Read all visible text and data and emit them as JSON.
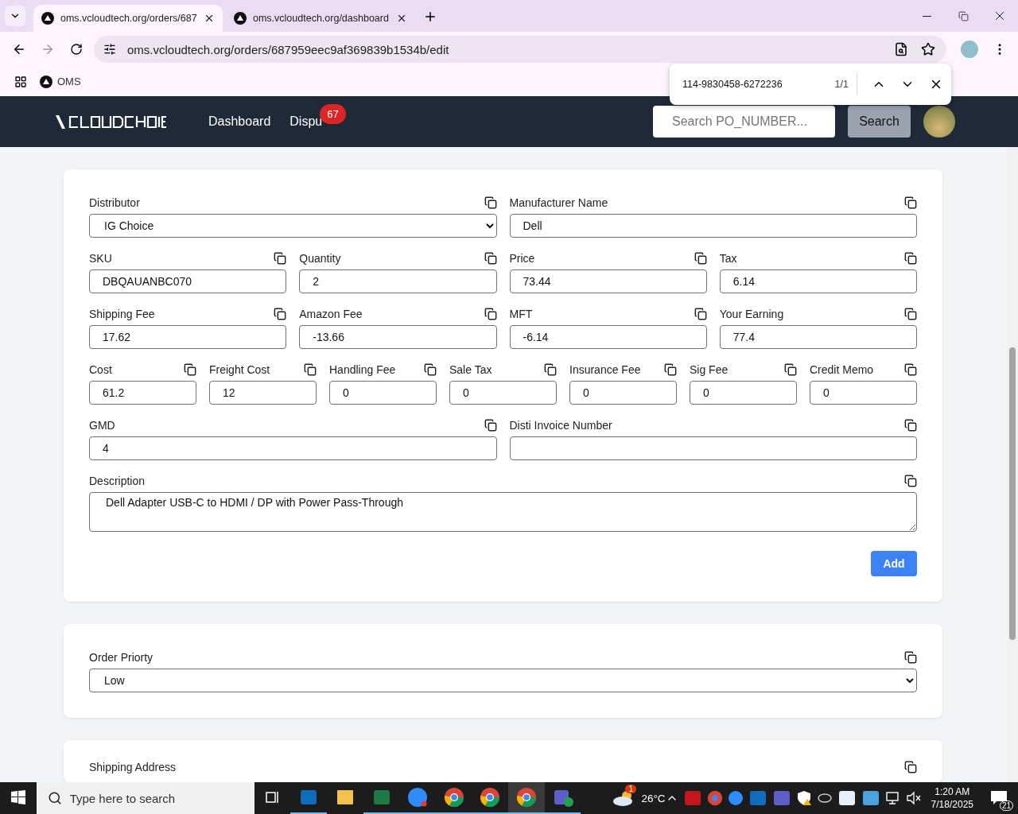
{
  "browser": {
    "tabs": [
      {
        "title": "oms.vcloudtech.org/orders/687",
        "selected": true
      },
      {
        "title": "oms.vcloudtech.org/dashboard",
        "selected": false
      }
    ],
    "url": "oms.vcloudtech.org/orders/687959eec9af369839b1534b/edit",
    "bookmarks": [
      "OMS"
    ],
    "find_bar": {
      "query": "114-9830458-6272236",
      "count": "1/1"
    }
  },
  "header": {
    "nav": [
      {
        "label": "Dashboard"
      },
      {
        "label": "Dispu",
        "badge": "67"
      }
    ],
    "search": {
      "placeholder": "Search PO_NUMBER..."
    },
    "search_button": "Search"
  },
  "item_form": {
    "rows": [
      {
        "fields": [
          {
            "label": "Distributor",
            "value": "IG Choice",
            "kind": "select"
          },
          {
            "label": "Manufacturer Name",
            "value": "Dell",
            "kind": "input"
          }
        ]
      },
      {
        "fields": [
          {
            "label": "SKU",
            "value": "DBQAUANBC070",
            "kind": "input"
          },
          {
            "label": "Quantity",
            "value": "2",
            "kind": "input"
          },
          {
            "label": "Price",
            "value": "73.44",
            "kind": "input"
          },
          {
            "label": "Tax",
            "value": "6.14",
            "kind": "input"
          }
        ]
      },
      {
        "fields": [
          {
            "label": "Shipping Fee",
            "value": "17.62",
            "kind": "input"
          },
          {
            "label": "Amazon Fee",
            "value": "-13.66",
            "kind": "input"
          },
          {
            "label": "MFT",
            "value": "-6.14",
            "kind": "input"
          },
          {
            "label": "Your Earning",
            "value": "77.4",
            "kind": "input"
          }
        ]
      },
      {
        "fields": [
          {
            "label": "Cost",
            "value": "61.2",
            "kind": "input"
          },
          {
            "label": "Freight Cost",
            "value": "12",
            "kind": "input"
          },
          {
            "label": "Handling Fee",
            "value": "0",
            "kind": "input"
          },
          {
            "label": "Sale Tax",
            "value": "0",
            "kind": "input"
          },
          {
            "label": "Insurance Fee",
            "value": "0",
            "kind": "input"
          },
          {
            "label": "Sig Fee",
            "value": "0",
            "kind": "input"
          },
          {
            "label": "Credit Memo",
            "value": "0",
            "kind": "input"
          }
        ]
      },
      {
        "fields": [
          {
            "label": "GMD",
            "value": "4",
            "kind": "input"
          },
          {
            "label": "Disti Invoice Number",
            "kind": "input"
          }
        ]
      },
      {
        "fields": [
          {
            "label": "Description",
            "value": "Dell Adapter USB-C to HDMI / DP with Power Pass-Through",
            "kind": "textarea"
          }
        ]
      }
    ],
    "add_button": "Add"
  },
  "priority": {
    "label": "Order Priorty",
    "value": "Low"
  },
  "shipping": {
    "label": "Shipping Address"
  },
  "taskbar": {
    "search_placeholder": "Type here to search",
    "weather": {
      "temp": "26°C",
      "badge": "1"
    },
    "time": "1:20 AM",
    "date": "7/18/2025",
    "notifications": "21"
  }
}
